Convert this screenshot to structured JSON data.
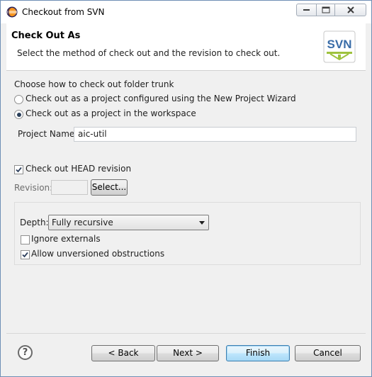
{
  "window": {
    "title": "Checkout from SVN",
    "icon": "eclipse-icon"
  },
  "banner": {
    "title": "Check Out As",
    "description": "Select the method of check out and the revision to check out.",
    "logo_text": "SVN"
  },
  "checkout": {
    "heading": "Choose how to check out folder trunk",
    "options": [
      {
        "label": "Check out as a project configured using the New Project Wizard",
        "selected": false
      },
      {
        "label": "Check out as a project in the workspace",
        "selected": true
      }
    ],
    "project_name_label": "Project Name:",
    "project_name_value": "aic-util"
  },
  "revision": {
    "head_label": "Check out HEAD revision",
    "head_checked": true,
    "revision_label": "Revision:",
    "revision_value": "",
    "select_button": "Select..."
  },
  "options_group": {
    "depth_label": "Depth:",
    "depth_value": "Fully recursive",
    "ignore_externals_label": "Ignore externals",
    "ignore_externals_checked": false,
    "allow_unversioned_label": "Allow unversioned obstructions",
    "allow_unversioned_checked": true
  },
  "footer": {
    "help_label": "?",
    "back_button": "< Back",
    "next_button": "Next >",
    "finish_button": "Finish",
    "cancel_button": "Cancel"
  },
  "colors": {
    "window_border": "#6f8fb5",
    "dialog_background": "#f0f0f0",
    "default_button_border": "#3c7fb1",
    "svn_logo_blue": "#3a6da8"
  }
}
